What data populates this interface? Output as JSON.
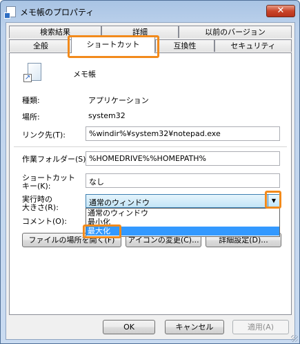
{
  "window": {
    "title": "メモ帳のプロパティ",
    "close_glyph": "✕"
  },
  "tabs": {
    "row1": [
      "検索結果",
      "詳細",
      "以前のバージョン"
    ],
    "row2": [
      "全般",
      "ショートカット",
      "互換性",
      "セキュリティ"
    ]
  },
  "file": {
    "name": "メモ帳"
  },
  "fields": {
    "type_label": "種類:",
    "type_value": "アプリケーション",
    "location_label": "場所:",
    "location_value": "system32",
    "target_label": "リンク先(T):",
    "target_value": "%windir%¥system32¥notepad.exe",
    "startin_label": "作業フォルダー(S):",
    "startin_value": "%HOMEDRIVE%%HOMEPATH%",
    "shortcut_label_1": "ショートカット",
    "shortcut_label_2": "キー(K):",
    "shortcut_value": "なし",
    "run_label_1": "実行時の",
    "run_label_2": "大きさ(R):",
    "run_value": "通常のウィンドウ",
    "comment_label": "コメント(O):"
  },
  "run_options": [
    "通常のウィンドウ",
    "最小化",
    "最大化"
  ],
  "buttons": {
    "open_location": "ファイルの場所を開く(F)",
    "change_icon": "アイコンの変更(C)...",
    "advanced": "詳細設定(D)...",
    "ok": "OK",
    "cancel": "キャンセル",
    "apply": "適用(A)"
  },
  "colors": {
    "highlight": "#f28a1b",
    "selection": "#3399ff"
  }
}
